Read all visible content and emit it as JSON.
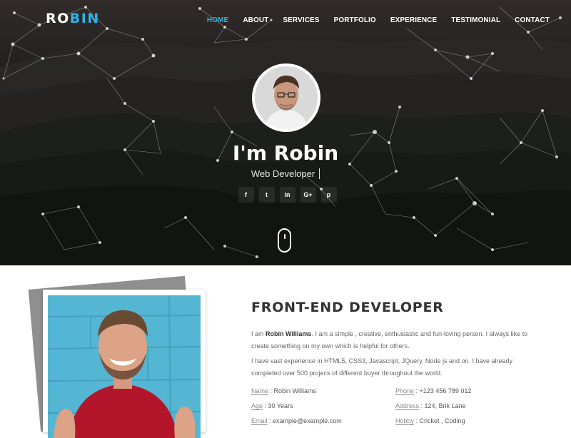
{
  "brand": {
    "logo_part1": "RO",
    "logo_part2": "BIN",
    "accent": "#2fb3e6"
  },
  "nav": {
    "items": [
      {
        "label": "HOME",
        "active": true
      },
      {
        "label": "ABOUT"
      },
      {
        "label": "SERVICES"
      },
      {
        "label": "PORTFOLIO"
      },
      {
        "label": "EXPERIENCE"
      },
      {
        "label": "TESTIMONIAL"
      },
      {
        "label": "CONTACT"
      }
    ]
  },
  "hero": {
    "title": "I'm Robin",
    "subtitle": "Web Developer",
    "socials": [
      {
        "icon": "facebook-icon",
        "glyph": "f"
      },
      {
        "icon": "twitter-icon",
        "glyph": "t"
      },
      {
        "icon": "linkedin-icon",
        "glyph": "in"
      },
      {
        "icon": "google-plus-icon",
        "glyph": "G+"
      },
      {
        "icon": "pinterest-icon",
        "glyph": "p"
      }
    ]
  },
  "about": {
    "title": "FRONT-END DEVELOPER",
    "intro_prefix": "I am ",
    "intro_name": "Robin Williams",
    "intro_suffix": ". I am a simple , creative, enthusiastic and fun-loving person. I always like to create something on my own which is helpful for others.",
    "paragraph2": "I have vast experience in HTML5, CSS3, Javascript, JQuery, Node js and on. I have already completed over 500 projecs of different buyer throughout the world.",
    "info": [
      {
        "key": "Name",
        "value": "Robin Williams"
      },
      {
        "key": "Phone",
        "value": "+123 456 789 012"
      },
      {
        "key": "Age",
        "value": "30 Years"
      },
      {
        "key": "Address",
        "value": "124, Brik Lane"
      },
      {
        "key": "Email",
        "value": "example@example.com"
      },
      {
        "key": "Hobby",
        "value": "Cricket , Coding"
      }
    ]
  }
}
